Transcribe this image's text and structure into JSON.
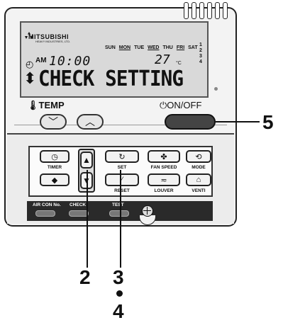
{
  "brand": {
    "name": "MITSUBISHI",
    "subname": "HEAVY INDUSTRIES, LTD."
  },
  "display": {
    "days": [
      "SUN",
      "MON",
      "TUE",
      "WED",
      "THU",
      "FRI",
      "SAT"
    ],
    "day_numbers": [
      "1",
      "2",
      "3",
      "4"
    ],
    "am": "AM",
    "time": "10:00",
    "temperature": "27",
    "temp_unit": "°C",
    "message": "CHECK SETTING"
  },
  "labels": {
    "temp": "TEMP",
    "onoff": "ON/OFF",
    "timer": "TIMER",
    "set": "SET",
    "reset": "RESET",
    "fan_speed": "FAN SPEED",
    "louver": "LOUVER",
    "mode": "MODE",
    "venti": "VENTI",
    "air_con_no": "AIR CON No.",
    "check": "CHECK",
    "test": "TEST"
  },
  "callouts": {
    "c5": "5",
    "c2": "2",
    "c3": "3",
    "c4": "4"
  },
  "icons": {
    "temp_down": "chevron-down-icon",
    "temp_up": "chevron-up-icon",
    "timer": "clock-icon",
    "set": "rotate-icon",
    "reset": "slash-icon",
    "fan_speed": "fan-icon",
    "louver": "louver-icon",
    "mode": "cycle-icon",
    "venti": "house-icon"
  }
}
